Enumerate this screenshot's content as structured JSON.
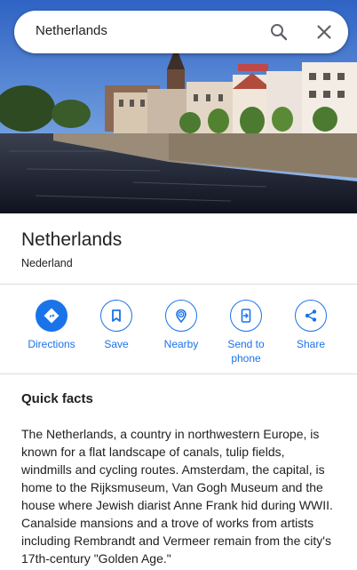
{
  "search": {
    "query": "Netherlands",
    "search_icon": "search-icon",
    "close_icon": "close-icon"
  },
  "place": {
    "title": "Netherlands",
    "subtitle": "Nederland"
  },
  "actions": [
    {
      "label": "Directions",
      "icon": "directions-icon"
    },
    {
      "label": "Save",
      "icon": "bookmark-icon"
    },
    {
      "label": "Nearby",
      "icon": "nearby-icon"
    },
    {
      "label": "Send to phone",
      "icon": "send-to-phone-icon"
    },
    {
      "label": "Share",
      "icon": "share-icon"
    }
  ],
  "quick_facts": {
    "title": "Quick facts",
    "body": "The Netherlands, a country in northwestern Europe, is known for a flat landscape of canals, tulip fields, windmills and cycling routes. Amsterdam, the capital, is home to the Rijksmuseum, Van Gogh Museum and the house where Jewish diarist Anne Frank hid during WWII. Canalside mansions and a trove of works from artists including Rembrandt and Vermeer remain from the city's 17th-century \"Golden Age.\""
  },
  "colors": {
    "accent": "#1a73e8",
    "divider": "#dadce0",
    "text": "#202124"
  }
}
